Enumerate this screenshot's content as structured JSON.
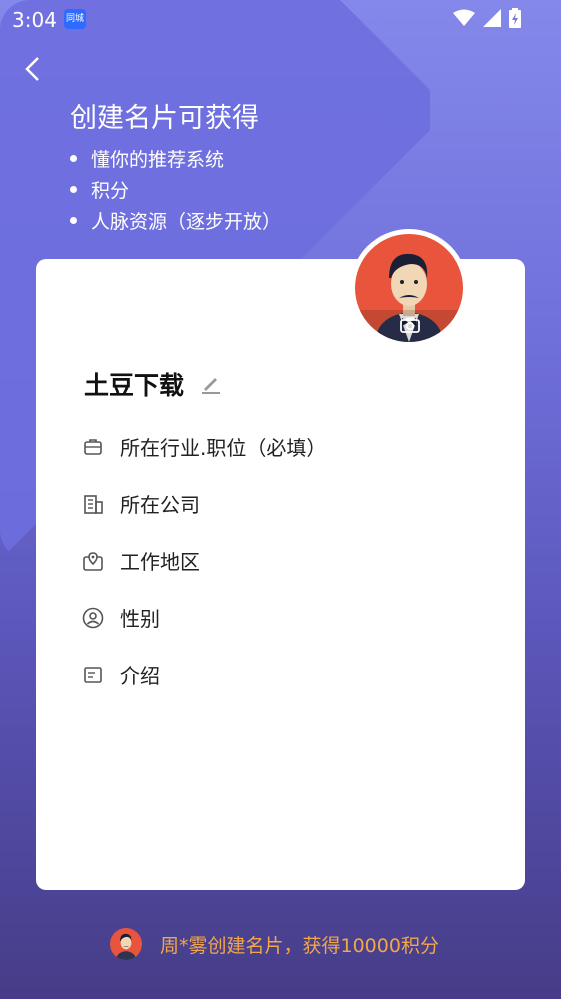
{
  "status_bar": {
    "time": "3:04",
    "badge": "同城"
  },
  "promo": {
    "title": "创建名片可获得",
    "items": [
      "懂你的推荐系统",
      "积分",
      "人脉资源（逐步开放）"
    ]
  },
  "profile": {
    "name": "土豆下载"
  },
  "fields": [
    {
      "label": "所在行业.职位（必填）",
      "icon": "briefcase-icon"
    },
    {
      "label": "所在公司",
      "icon": "building-icon"
    },
    {
      "label": "工作地区",
      "icon": "location-icon"
    },
    {
      "label": "性别",
      "icon": "user-circle-icon"
    },
    {
      "label": "介绍",
      "icon": "note-icon"
    }
  ],
  "footer": {
    "text": "周*雾创建名片，获得10000积分"
  },
  "colors": {
    "accent": "#f3a64a",
    "avatar_bg": "#e8553c",
    "card_bg": "#ffffff"
  }
}
